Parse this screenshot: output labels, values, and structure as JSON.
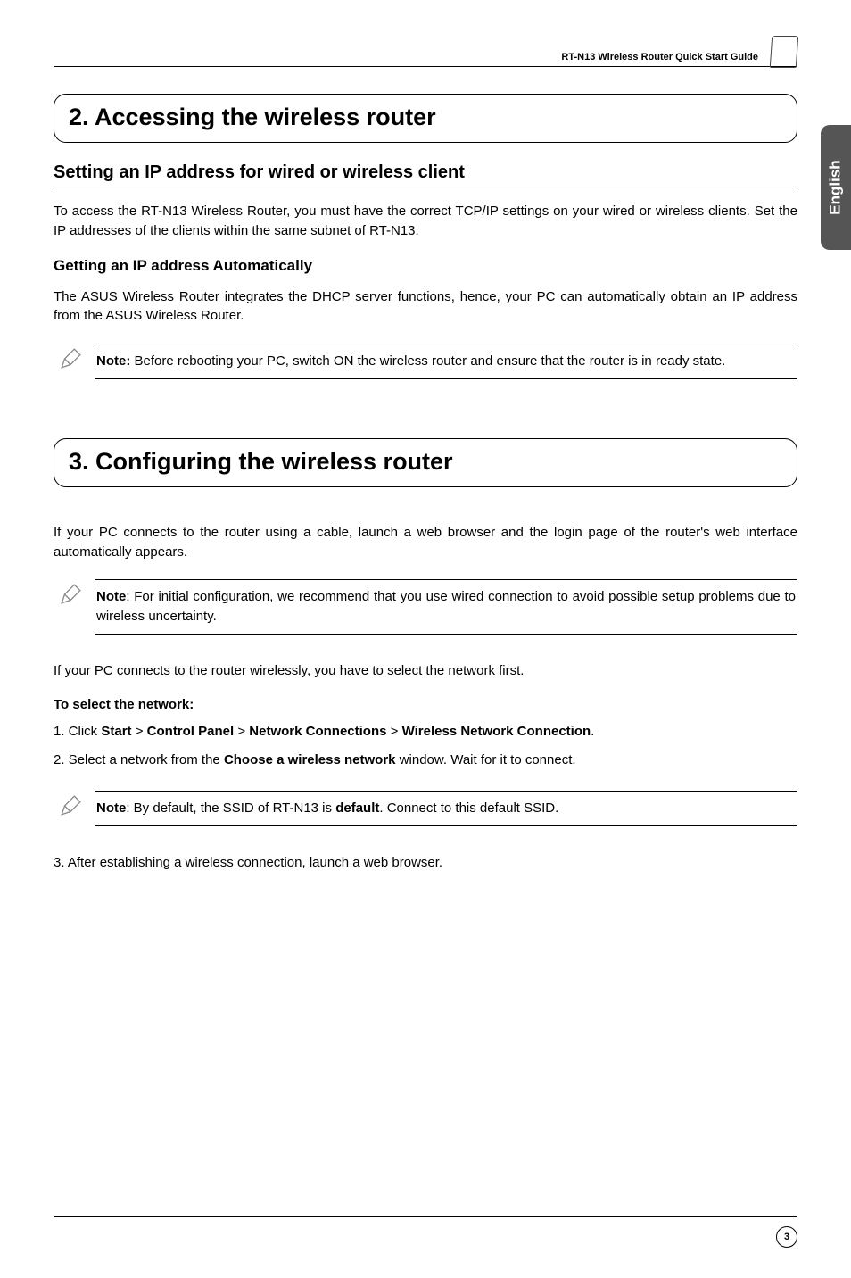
{
  "header": {
    "text": "RT-N13 Wireless Router Quick Start Guide"
  },
  "sideTab": {
    "language": "English"
  },
  "section2": {
    "title": "2. Accessing the wireless router",
    "subheading": "Setting an IP address for wired or wireless client",
    "intro": "To access the RT-N13 Wireless Router, you must have the correct TCP/IP settings on your wired or wireless clients. Set the IP addresses of the clients within the same subnet of RT-N13.",
    "subsub": "Getting an IP address Automatically",
    "body2": "The ASUS Wireless Router integrates the DHCP server functions, hence, your PC can automatically obtain an IP address from the ASUS Wireless Router.",
    "note": {
      "label": "Note:",
      "text": " Before rebooting your PC, switch ON the wireless router and ensure that the router is in ready state."
    }
  },
  "section3": {
    "title": "3. Configuring the wireless router",
    "intro": "If your PC connects to the router using a cable, launch a web browser and the login page of the router's web interface automatically appears.",
    "note1": {
      "label": "Note",
      "text": ":   For initial configuration, we recommend that you use wired connection to avoid possible setup problems due to wireless uncertainty."
    },
    "wirelessIntro": "If your PC connects to the router wirelessly, you have to select the network first.",
    "listLabel": "To select the network:",
    "step1": {
      "num": "1.",
      "prefix": "  Click ",
      "p1": "Start",
      "sep1": " > ",
      "p2": "Control Panel",
      "sep2": " > ",
      "p3": "Network Connections",
      "sep3": " > ",
      "p4": "Wireless Network Connection",
      "suffix": "."
    },
    "step2": {
      "num": "2.",
      "prefix": "  Select a network from the ",
      "bold": "Choose a wireless network",
      "suffix": " window. Wait for it to connect."
    },
    "note2": {
      "label": "Note",
      "text1": ":   By default, the SSID of RT-N13 is ",
      "b1": "default",
      "text2": ". Connect to this default SSID."
    },
    "step3": {
      "num": "3.",
      "text": "  After establishing a wireless connection, launch a web browser."
    }
  },
  "footer": {
    "pageNum": "3"
  }
}
